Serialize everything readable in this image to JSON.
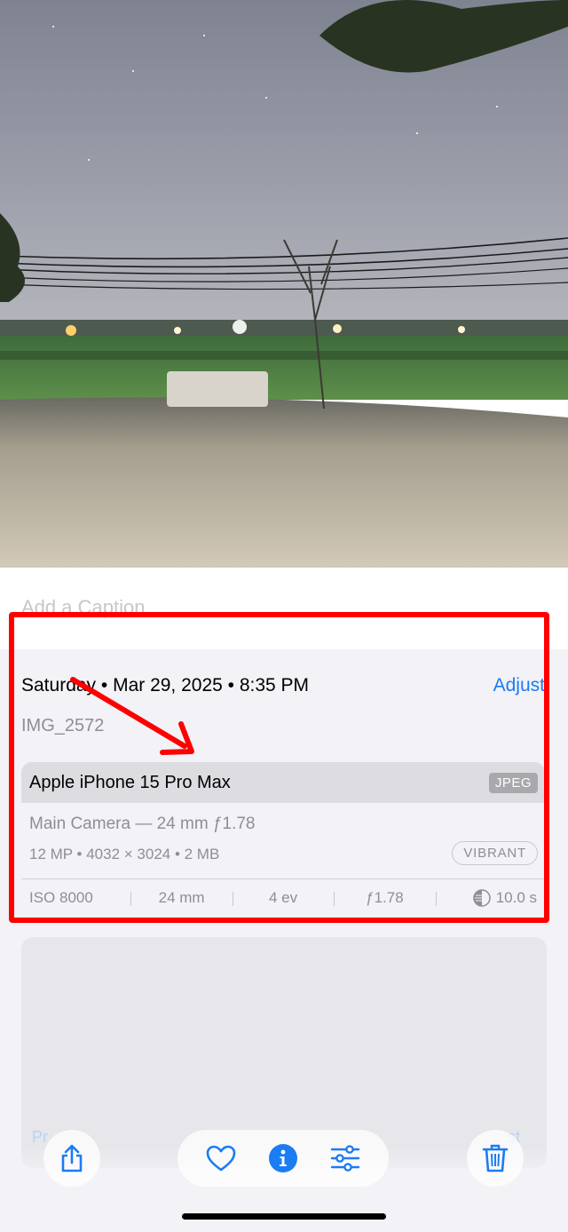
{
  "photo": {
    "description_icon": "night-landscape-photo"
  },
  "caption": {
    "placeholder": "Add a Caption",
    "value": ""
  },
  "metadata": {
    "date_line": "Saturday • Mar 29, 2025 • 8:35 PM",
    "adjust_label": "Adjust",
    "filename": "IMG_2572"
  },
  "exif": {
    "device": "Apple iPhone 15 Pro Max",
    "format": "JPEG",
    "lens": "Main Camera — 24 mm ƒ1.78",
    "specs": "12 MP • 4032 × 3024 • 2 MB",
    "style": "VIBRANT",
    "stats": {
      "iso": "ISO 8000",
      "focal": "24 mm",
      "ev": "4 ev",
      "aperture": "ƒ1.78",
      "shutter": "10.0 s"
    }
  },
  "map_card": {
    "left_faint": "Pr",
    "right_faint": "st"
  },
  "toolbar": {
    "share_icon": "share-icon",
    "favorite_icon": "heart-icon",
    "info_icon": "info-icon",
    "adjust_icon": "sliders-icon",
    "delete_icon": "trash-icon"
  },
  "colors": {
    "accent": "#1b7cf3",
    "annotation": "#ff0000",
    "background": "#f2f2f7"
  }
}
